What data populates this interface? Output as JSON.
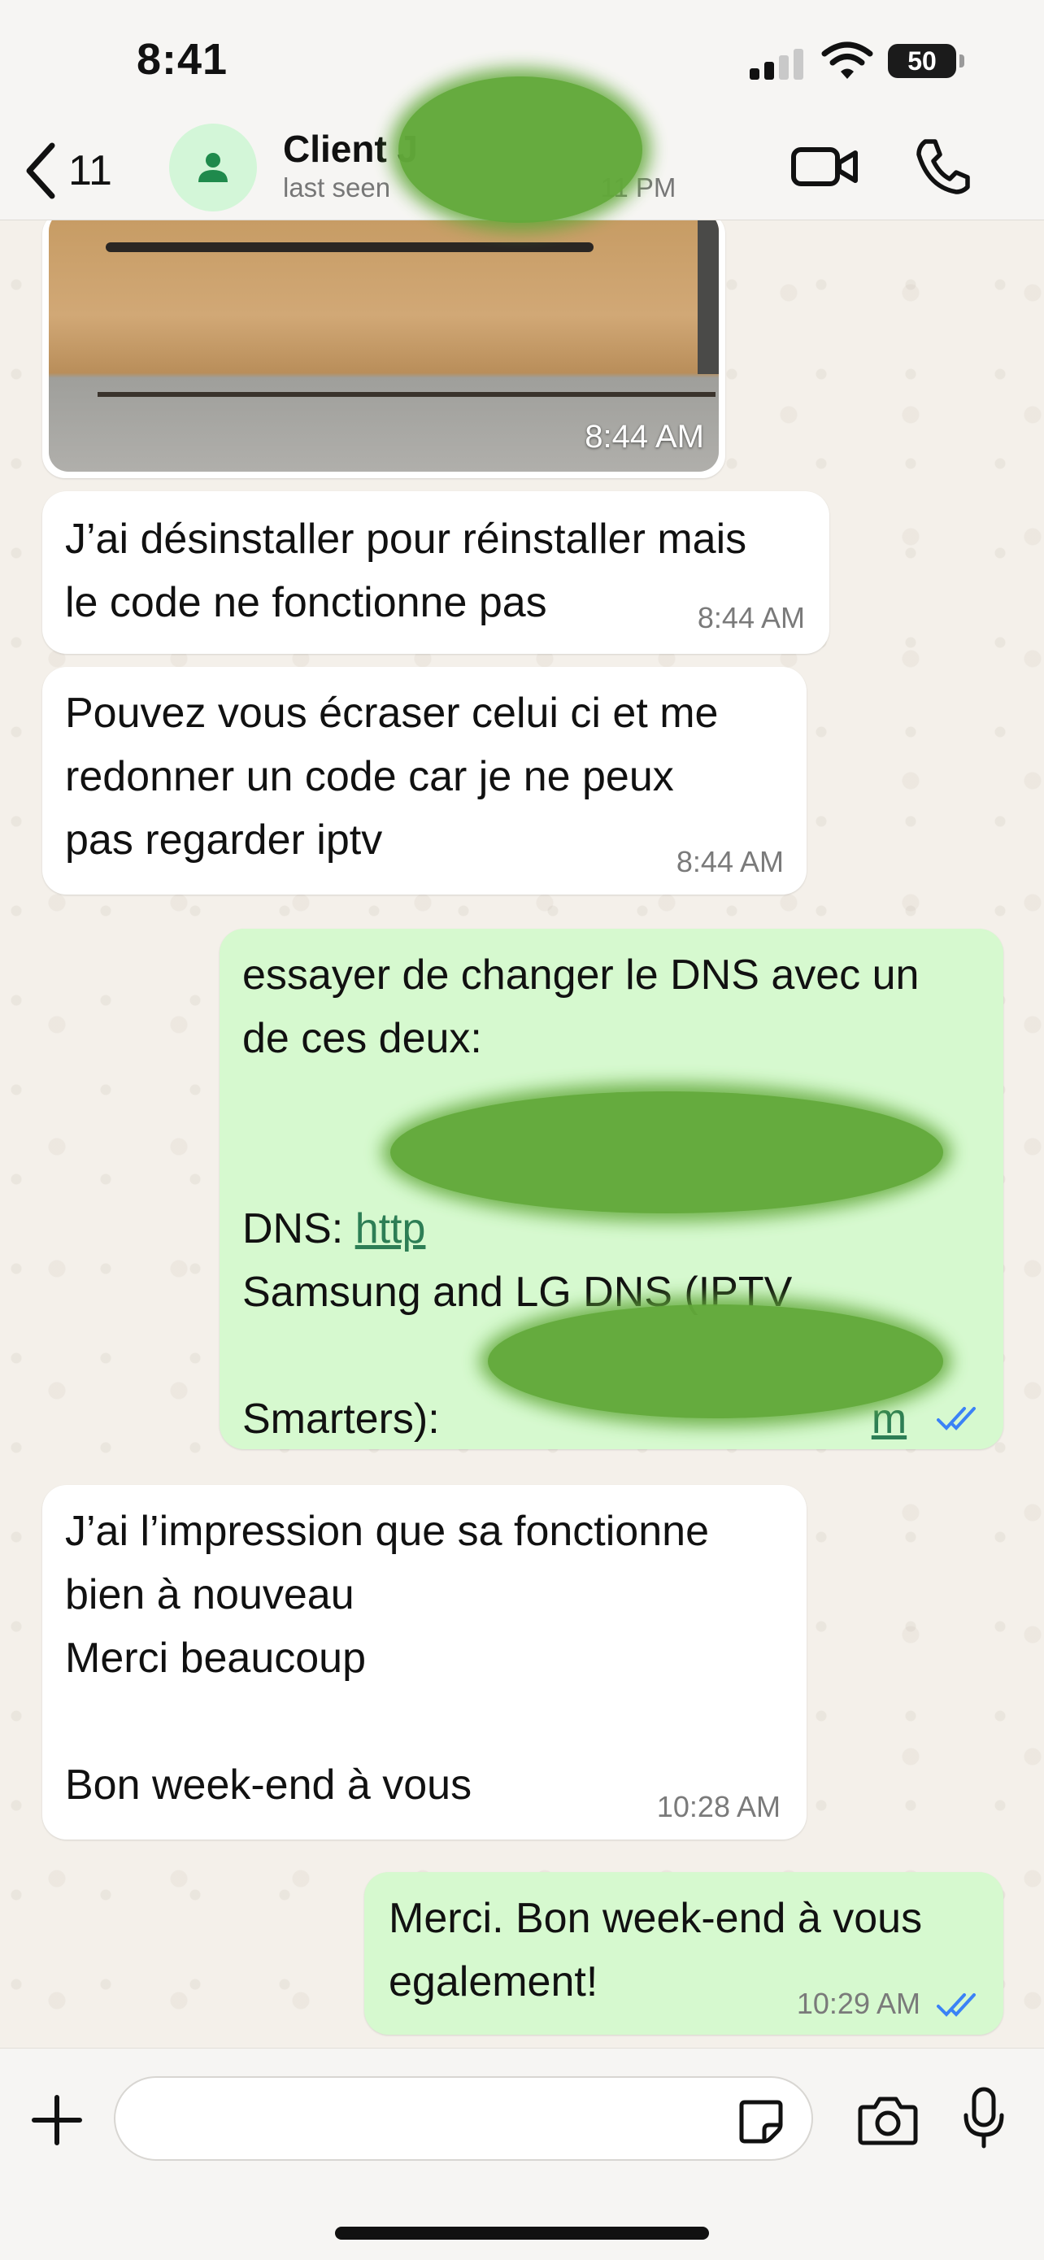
{
  "status_bar": {
    "time": "8:41",
    "battery": "50"
  },
  "header": {
    "back_count": "11",
    "contact_name": "Client J",
    "last_seen": "last seen",
    "last_seen_suffix": "11 PM"
  },
  "messages": {
    "image": {
      "time": "8:44 AM"
    },
    "m1": {
      "text": "J’ai désinstaller pour réinstaller mais\nle code ne fonctionne pas",
      "time": "8:44 AM"
    },
    "m2": {
      "text": "Pouvez vous écraser celui ci et me\nredonner un code car je ne peux\npas regarder iptv",
      "time": "8:44 AM"
    },
    "m3": {
      "line1": "essayer de changer le DNS avec un",
      "line2": "de ces deux:",
      "dns_label": "DNS: ",
      "dns_link": "http",
      "samsung_line1": "Samsung and LG DNS (IPTV",
      "samsung_line2": "Smarters): ",
      "samsung_link_end": "m"
    },
    "m4": {
      "text": "J’ai l’impression que sa fonctionne\nbien à nouveau\nMerci beaucoup\n\nBon week-end à vous",
      "time": "10:28 AM"
    },
    "m5": {
      "text": "Merci. Bon week-end à vous\negalement!",
      "time": "10:29 AM"
    }
  },
  "composer": {
    "placeholder": ""
  },
  "colors": {
    "incoming": "#ffffff",
    "outgoing": "#d6f9cf",
    "link": "#2d7e55",
    "read_ticks": "#3b82f6",
    "redaction": "#62a93a"
  },
  "icons": [
    "back-chevron-icon",
    "person-icon",
    "video-camera-icon",
    "phone-icon",
    "plus-icon",
    "sticker-icon",
    "camera-icon",
    "microphone-icon",
    "double-check-icon"
  ]
}
